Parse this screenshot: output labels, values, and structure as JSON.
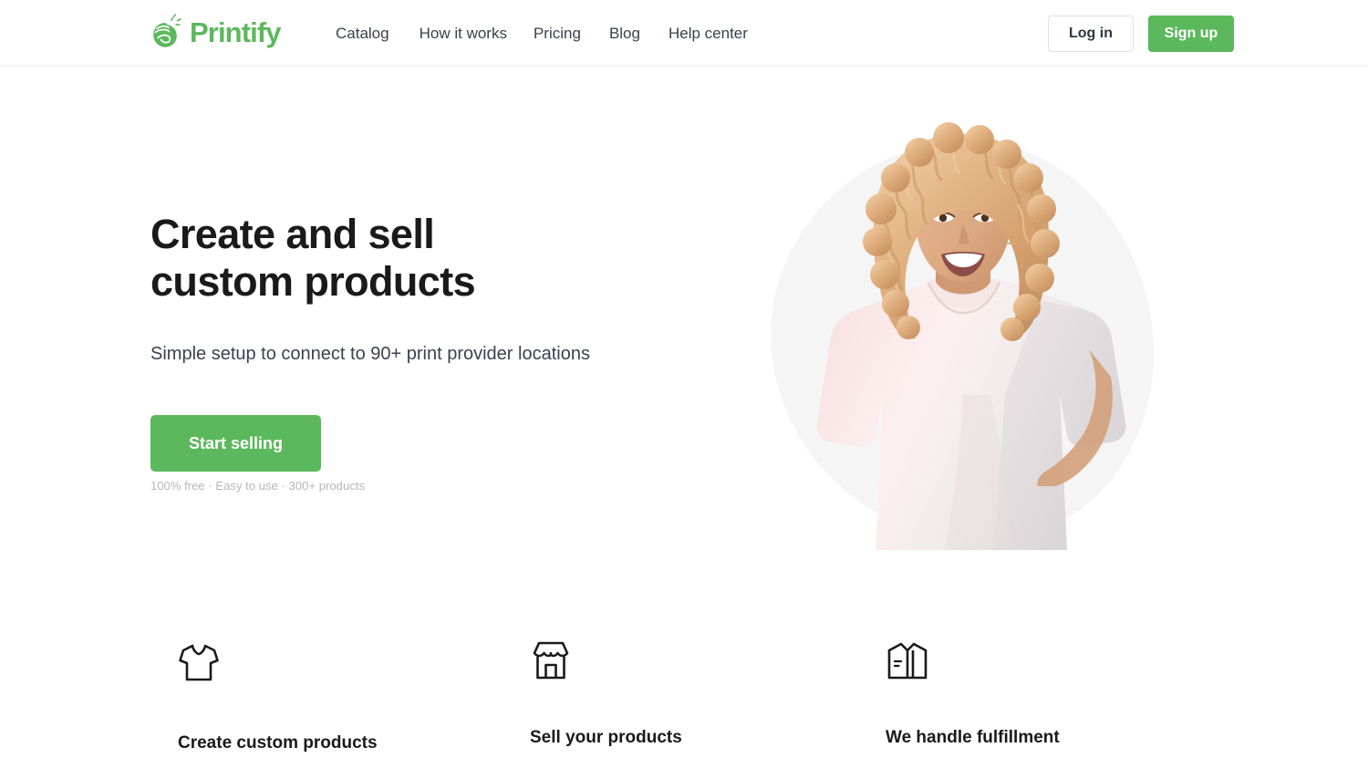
{
  "brand": {
    "name": "Printify",
    "logo_icon": "printify-hand-icon",
    "green": "#5cb85c"
  },
  "header": {
    "nav": [
      {
        "label": "Catalog"
      },
      {
        "label": "How it works"
      },
      {
        "label": "Pricing"
      },
      {
        "label": "Blog"
      },
      {
        "label": "Help center"
      }
    ],
    "login_label": "Log in",
    "signup_label": "Sign up"
  },
  "hero": {
    "title": "Create and sell\ncustom products",
    "subtitle": "Simple setup to connect to 90+ print provider locations",
    "cta_label": "Start selling",
    "note": "100% free · Easy to use  · 300+ products",
    "image_alt": "smiling woman with curly blonde hair wearing a light pink t-shirt",
    "blob_color": "#f6f5f5"
  },
  "features": [
    {
      "icon": "tshirt-icon",
      "title": "Create custom products"
    },
    {
      "icon": "storefront-icon",
      "title": "Sell your products"
    },
    {
      "icon": "open-box-icon",
      "title": "We handle fulfillment"
    }
  ]
}
